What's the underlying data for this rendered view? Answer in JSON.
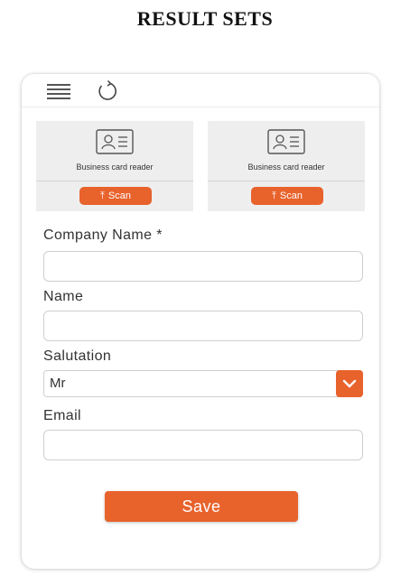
{
  "heading": "RESULT SETS",
  "toolbar": {
    "menu_icon": "hamburger-icon",
    "refresh_icon": "refresh-icon"
  },
  "scan_cards": [
    {
      "label": "Business card reader",
      "button_label": "Scan",
      "icon": "id-card-icon"
    },
    {
      "label": "Business card reader",
      "button_label": "Scan",
      "icon": "id-card-icon"
    }
  ],
  "form": {
    "company_name": {
      "label": "Company Name *",
      "value": "",
      "placeholder": ""
    },
    "name": {
      "label": "Name",
      "value": "",
      "placeholder": ""
    },
    "salutation": {
      "label": "Salutation",
      "selected": "Mr"
    },
    "email": {
      "label": "Email",
      "value": "",
      "placeholder": ""
    }
  },
  "save_label": "Save",
  "colors": {
    "accent": "#e8622c",
    "card_bg": "#eeeeee"
  }
}
